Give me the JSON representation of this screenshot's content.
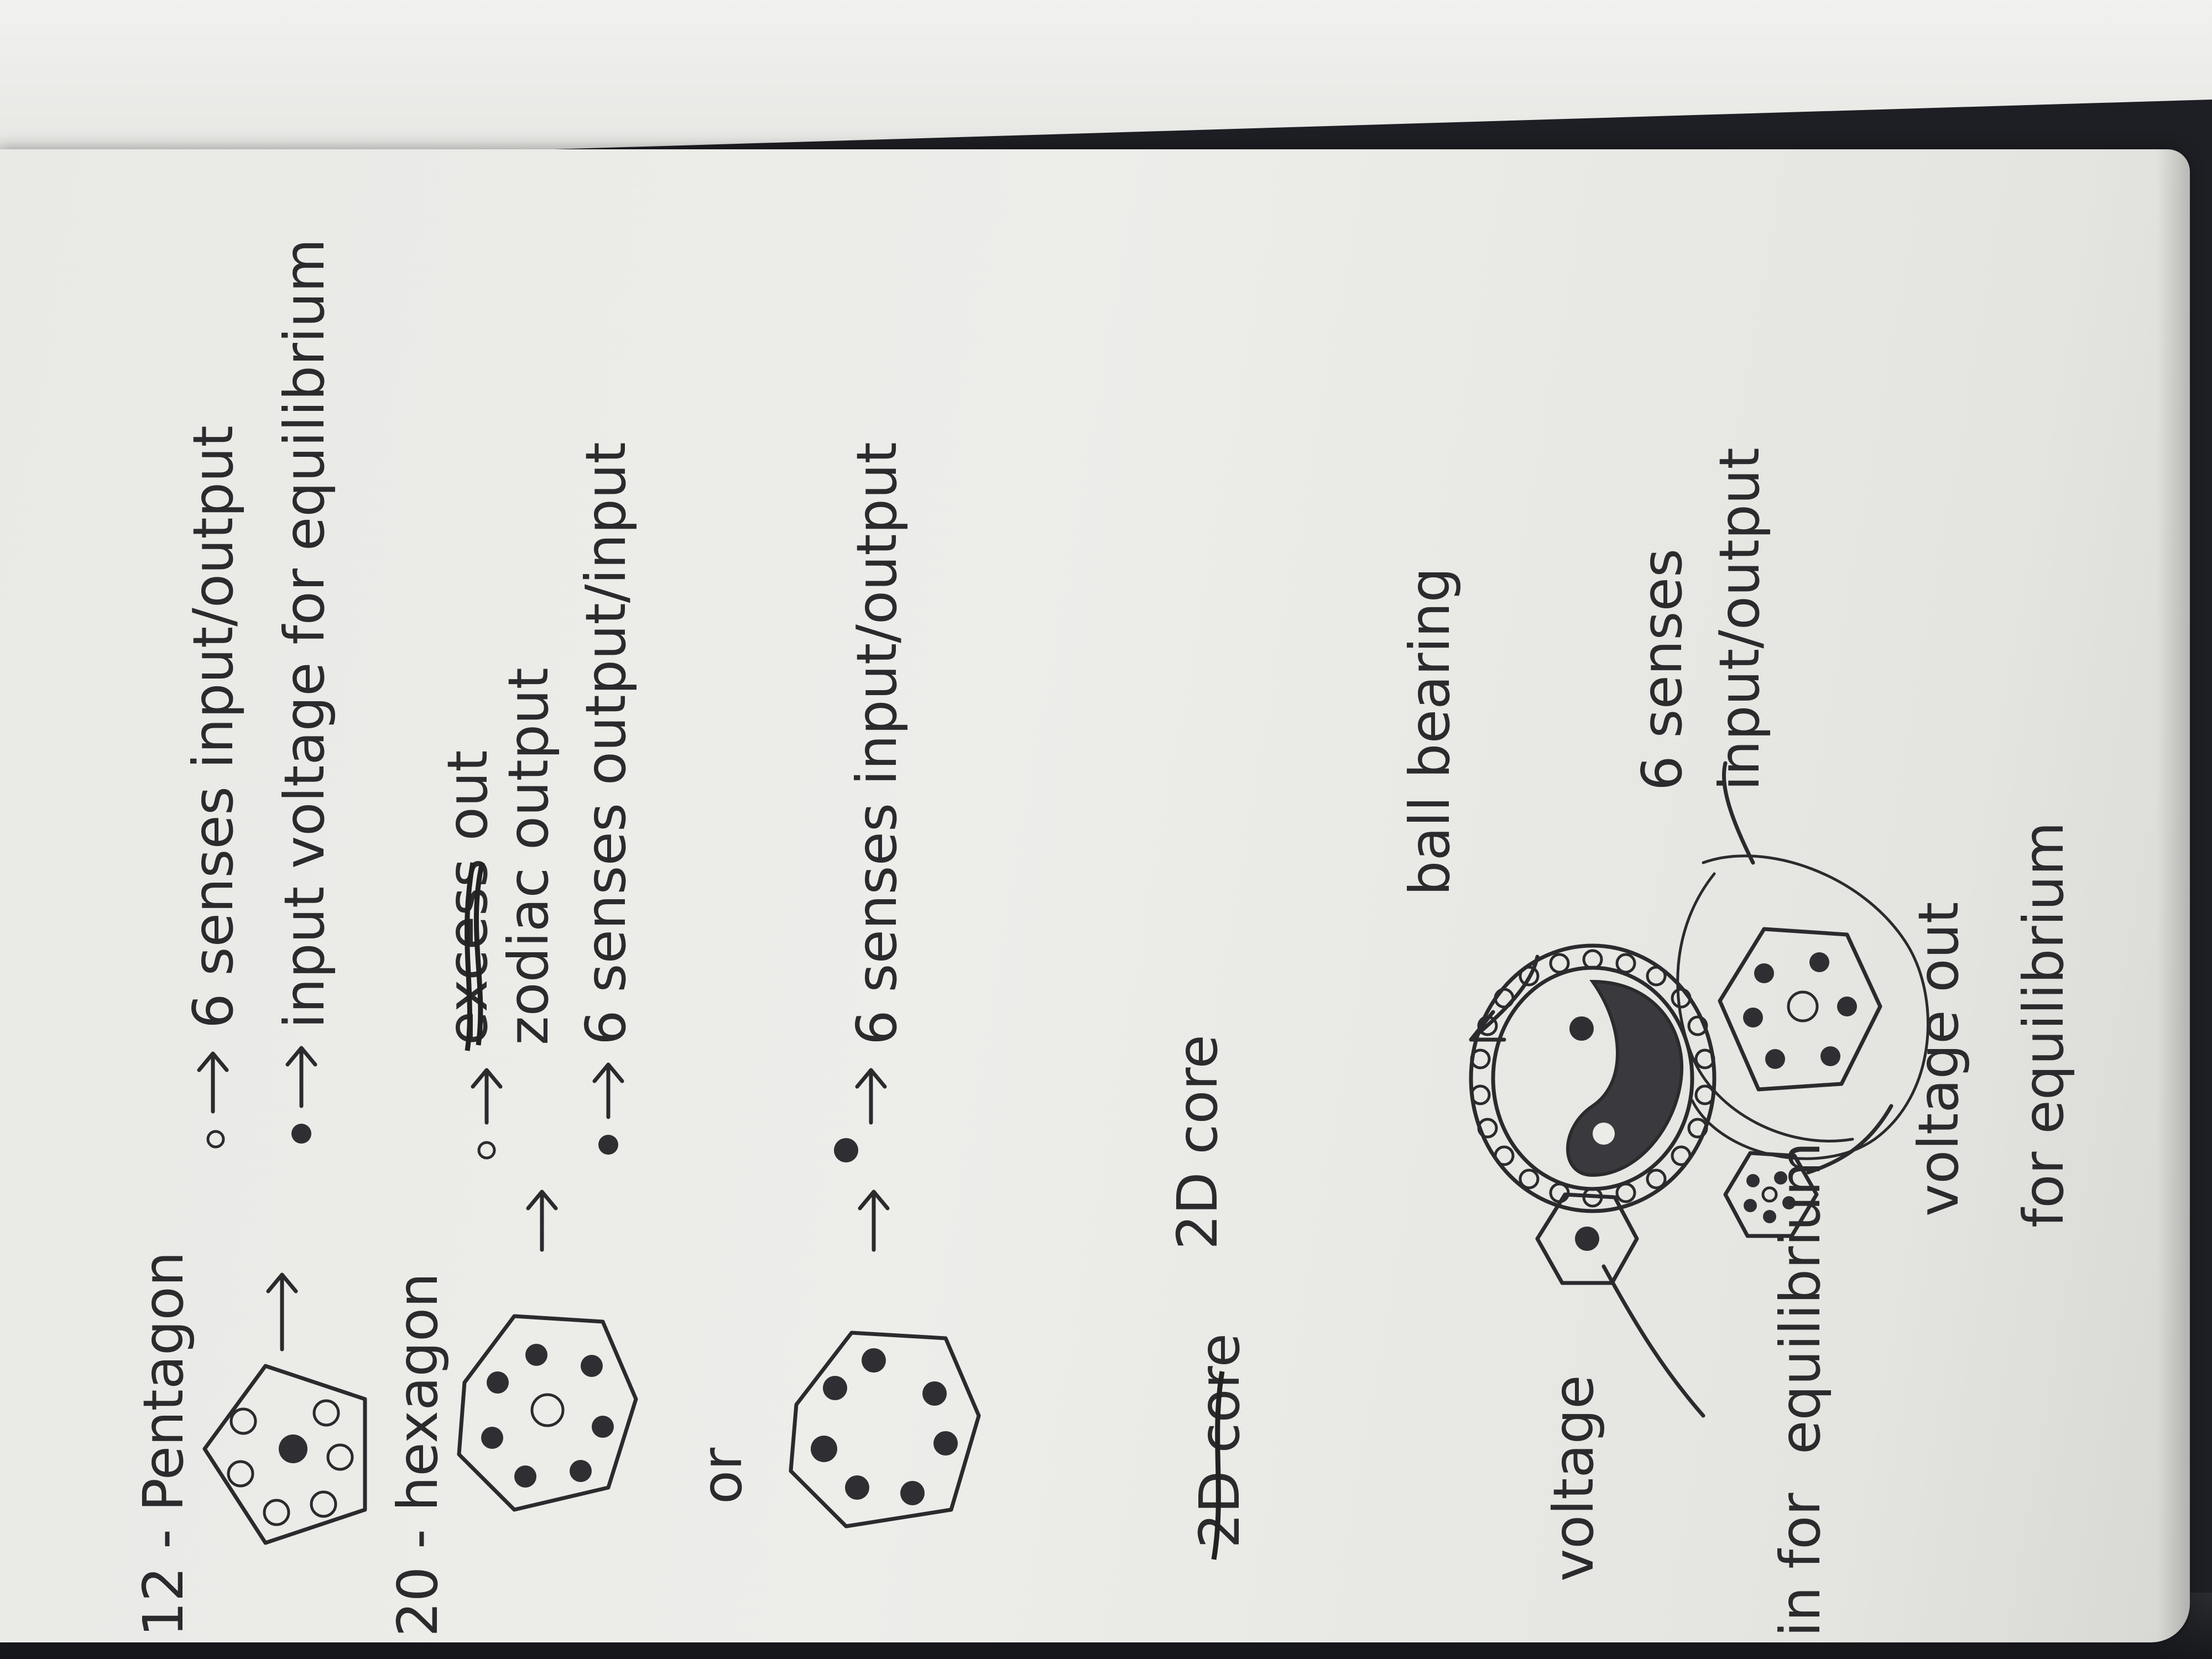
{
  "notes": {
    "pentagon_heading": "12 - Pentagon",
    "pentagon_line1": "6 senses input/output",
    "pentagon_line2": "input voltage for equilibrium",
    "hexagon_heading": "20 - hexagon",
    "hexagon_struck": "excess out",
    "hexagon_line1": "zodiac output",
    "hexagon_line2": "6 senses output/input",
    "or_label": "or",
    "alt_line": "6 senses input/output",
    "core_struck": "2D core",
    "core_label": "2D core",
    "ball_bearing": "ball bearing",
    "senses_label": "6 senses",
    "senses_io": "input/output",
    "voltage_out": "voltage out",
    "for_equilibrium": "for equilibrium",
    "voltage_in": "voltage",
    "in_for": "in for",
    "equilibrium_in": "equilibrium"
  },
  "colors": {
    "ink": "#2b2b2e",
    "paper": "#ebebe8",
    "background": "#1e1f24"
  }
}
